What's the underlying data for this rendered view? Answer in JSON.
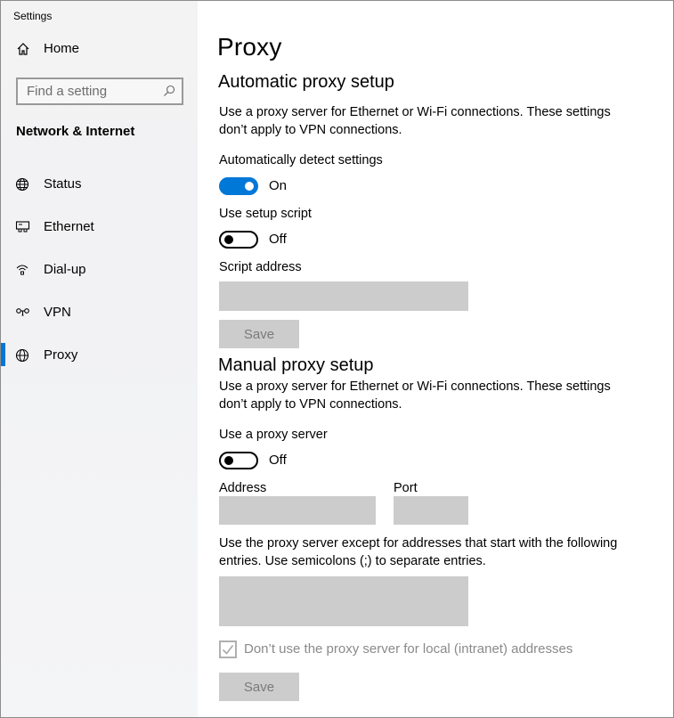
{
  "window": {
    "title": "Settings"
  },
  "sidebar": {
    "home_label": "Home",
    "search_placeholder": "Find a setting",
    "section_title": "Network & Internet",
    "items": [
      {
        "label": "Status",
        "icon": "globe-status-icon"
      },
      {
        "label": "Ethernet",
        "icon": "ethernet-icon"
      },
      {
        "label": "Dial-up",
        "icon": "dialup-icon"
      },
      {
        "label": "VPN",
        "icon": "vpn-icon"
      },
      {
        "label": "Proxy",
        "icon": "globe-icon",
        "selected": true
      }
    ]
  },
  "content": {
    "page_title": "Proxy",
    "auto": {
      "heading": "Automatic proxy setup",
      "description": "Use a proxy server for Ethernet or Wi-Fi connections. These settings don’t apply to VPN connections.",
      "detect_label": "Automatically detect settings",
      "detect_state": "On",
      "script_label": "Use setup script",
      "script_state": "Off",
      "script_address_label": "Script address",
      "script_address_value": "",
      "save_label": "Save"
    },
    "manual": {
      "heading": "Manual proxy setup",
      "description": "Use a proxy server for Ethernet or Wi-Fi connections. These settings don’t apply to VPN connections.",
      "use_proxy_label": "Use a proxy server",
      "use_proxy_state": "Off",
      "address_label": "Address",
      "address_value": "",
      "port_label": "Port",
      "port_value": "",
      "exceptions_description": "Use the proxy server except for addresses that start with the following entries. Use semicolons (;) to separate entries.",
      "exceptions_value": "",
      "local_checkbox_label": "Don’t use the proxy server for local (intranet) addresses",
      "local_checkbox_checked": true,
      "save_label": "Save"
    }
  },
  "colors": {
    "accent": "#0078d7",
    "disabled_field": "#cccccc"
  }
}
